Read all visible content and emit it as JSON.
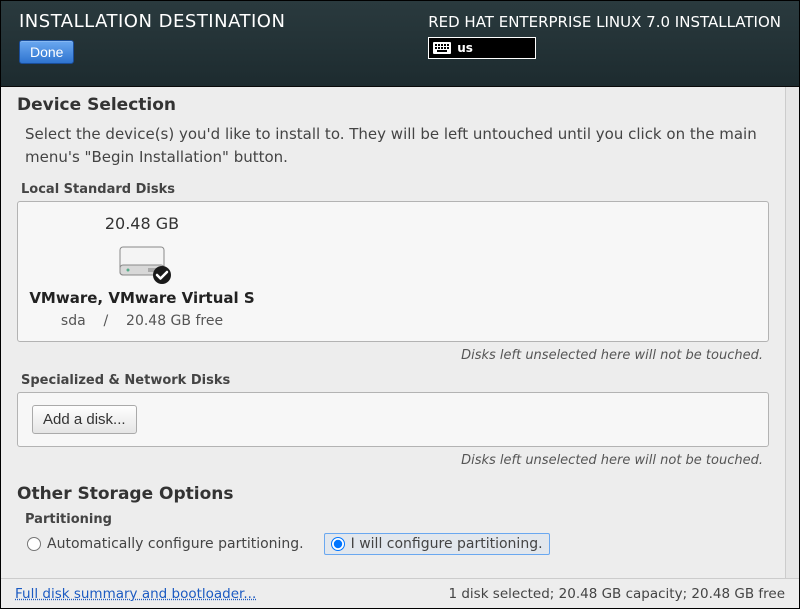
{
  "header": {
    "title": "INSTALLATION DESTINATION",
    "done_label": "Done",
    "subtitle": "RED HAT ENTERPRISE LINUX 7.0 INSTALLATION",
    "lang": "us"
  },
  "device_selection": {
    "heading": "Device Selection",
    "intro": "Select the device(s) you'd like to install to.  They will be left untouched until you click on the main menu's \"Begin Installation\" button.",
    "local_label": "Local Standard Disks",
    "disks": [
      {
        "size": "20.48 GB",
        "name": "VMware, VMware Virtual S",
        "id": "sda",
        "sep": "/",
        "free": "20.48 GB free",
        "selected": true
      }
    ],
    "hint": "Disks left unselected here will not be touched.",
    "network_label": "Specialized & Network Disks",
    "add_disk_label": "Add a disk...",
    "hint2": "Disks left unselected here will not be touched."
  },
  "storage": {
    "heading": "Other Storage Options",
    "partitioning_label": "Partitioning",
    "options": {
      "auto": "Automatically configure partitioning.",
      "manual": "I will configure partitioning."
    },
    "selected": "manual"
  },
  "footer": {
    "link": "Full disk summary and bootloader...",
    "status": "1 disk selected; 20.48 GB capacity; 20.48 GB free"
  }
}
